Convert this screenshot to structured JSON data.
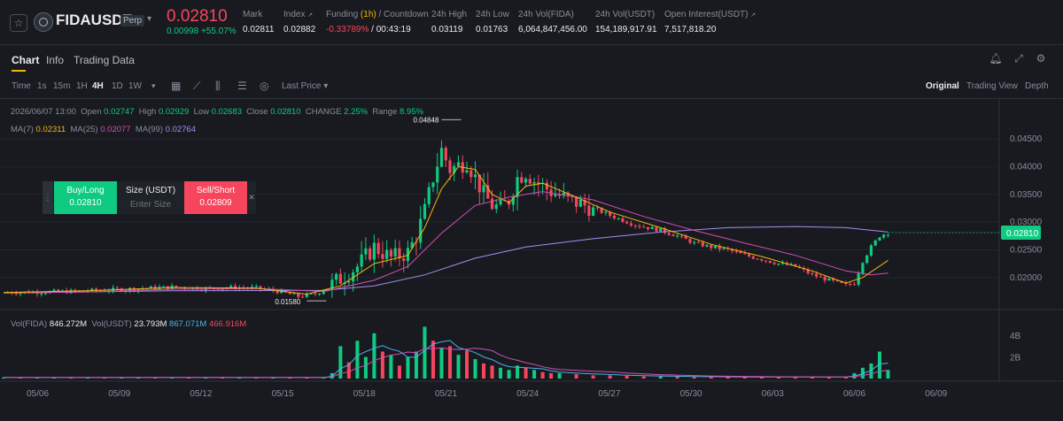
{
  "header": {
    "star_icon": "star-icon",
    "symbol": "FIDAUSDT",
    "contract_type": "Perp",
    "last_price": "0.02810",
    "change_abs": "0.00998",
    "change_pct": "+55.07%",
    "mark_label": "Mark",
    "mark_value": "0.02811",
    "index_label": "Index",
    "index_value": "0.02882",
    "funding_label": "Funding",
    "funding_interval": "(1h)",
    "countdown_label": "/ Countdown",
    "funding_rate": "-0.33789%",
    "countdown_value": "/ 00:43:19",
    "high_label": "24h High",
    "high_value": "0.03119",
    "low_label": "24h Low",
    "low_value": "0.01763",
    "vol_base_label": "24h Vol(FIDA)",
    "vol_base_value": "6,064,847,456.00",
    "vol_quote_label": "24h Vol(USDT)",
    "vol_quote_value": "154,189,917.91",
    "oi_label": "Open Interest(USDT)",
    "oi_value": "7,517,818.20"
  },
  "tabs": [
    {
      "label": "Chart"
    },
    {
      "label": "Info"
    },
    {
      "label": "Trading Data"
    }
  ],
  "toolbar": {
    "intervals": [
      "Time",
      "1s",
      "15m",
      "1H",
      "4H",
      "1D",
      "1W"
    ],
    "active_interval": "4H",
    "price_type": "Last Price",
    "views": [
      "Original",
      "Trading View",
      "Depth"
    ],
    "active_view": "Original"
  },
  "ohlc": {
    "date": "2026/06/07 13:00",
    "open_label": "Open",
    "open": "0.02747",
    "high_label": "High",
    "high": "0.02929",
    "low_label": "Low",
    "low": "0.02683",
    "close_label": "Close",
    "close": "0.02810",
    "change_label": "CHANGE",
    "change": "2.25%",
    "range_label": "Range",
    "range": "8.95%"
  },
  "ma": {
    "ma7_label": "MA(7)",
    "ma7": "0.02311",
    "ma25_label": "MA(25)",
    "ma25": "0.02077",
    "ma99_label": "MA(99)",
    "ma99": "0.02764"
  },
  "trade_panel": {
    "buy_label": "Buy/Long",
    "buy_price": "0.02810",
    "size_label": "Size (USDT)",
    "size_placeholder": "Enter Size",
    "sell_label": "Sell/Short",
    "sell_price": "0.02809"
  },
  "volume_legend": {
    "vol_fida_label": "Vol(FIDA)",
    "vol_fida": "846.272M",
    "vol_usdt_label": "Vol(USDT)",
    "vol_usdt": "23.793M",
    "ma1": "867.071M",
    "ma2": "466.916M"
  },
  "colors": {
    "up": "#0ecb81",
    "down": "#f6465d",
    "accent": "#f0b90b",
    "ma7": "#f0b90b",
    "ma25": "#d34fb5",
    "ma99": "#a68ef0"
  },
  "chart_data": {
    "type": "candlestick",
    "y_axis_ticks": [
      0.045,
      0.04,
      0.035,
      0.03,
      0.025,
      0.02
    ],
    "y_axis_labels": [
      "0.04500",
      "0.04000",
      "0.03500",
      "0.03000",
      "0.02500",
      "0.02000"
    ],
    "ylim": [
      0.0155,
      0.049
    ],
    "x_axis_labels": [
      "05/06",
      "05/09",
      "05/12",
      "05/15",
      "05/18",
      "05/21",
      "05/24",
      "05/27",
      "05/30",
      "06/03",
      "06/06",
      "06/09"
    ],
    "current_price_label": "0.02810",
    "current_price": 0.0281,
    "annotations": [
      {
        "text": "0.04848",
        "value": 0.04848
      },
      {
        "text": "0.01580",
        "value": 0.0158
      }
    ],
    "close_path": [
      [
        0,
        0.0173
      ],
      [
        8,
        0.0175
      ],
      [
        16,
        0.018
      ],
      [
        20,
        0.0183
      ],
      [
        24,
        0.018
      ],
      [
        27,
        0.0182
      ],
      [
        30,
        0.0181
      ],
      [
        33,
        0.0174
      ],
      [
        35,
        0.0166
      ],
      [
        37,
        0.017
      ],
      [
        38,
        0.0178
      ],
      [
        40,
        0.0198
      ],
      [
        42,
        0.022
      ],
      [
        44,
        0.0255
      ],
      [
        46,
        0.0235
      ],
      [
        48,
        0.0245
      ],
      [
        49,
        0.0275
      ],
      [
        50,
        0.032
      ],
      [
        51,
        0.038
      ],
      [
        52,
        0.043
      ],
      [
        53,
        0.0395
      ],
      [
        55,
        0.041
      ],
      [
        56,
        0.038
      ],
      [
        57,
        0.035
      ],
      [
        58,
        0.033
      ],
      [
        59,
        0.0325
      ],
      [
        60,
        0.034
      ],
      [
        61,
        0.038
      ],
      [
        62,
        0.039
      ],
      [
        63,
        0.0375
      ],
      [
        65,
        0.0355
      ],
      [
        67,
        0.034
      ],
      [
        70,
        0.0325
      ],
      [
        72,
        0.0312
      ],
      [
        75,
        0.0295
      ],
      [
        78,
        0.0285
      ],
      [
        80,
        0.0275
      ],
      [
        82,
        0.0262
      ],
      [
        84,
        0.0255
      ],
      [
        86,
        0.025
      ],
      [
        88,
        0.024
      ],
      [
        90,
        0.0233
      ],
      [
        92,
        0.0225
      ],
      [
        94,
        0.022
      ],
      [
        96,
        0.0205
      ],
      [
        98,
        0.0195
      ],
      [
        100,
        0.0186
      ],
      [
        101,
        0.019
      ],
      [
        102,
        0.023
      ],
      [
        103,
        0.0255
      ],
      [
        104,
        0.0275
      ],
      [
        105,
        0.0281
      ]
    ],
    "ma7": [
      [
        0,
        0.0173
      ],
      [
        10,
        0.0176
      ],
      [
        20,
        0.0182
      ],
      [
        30,
        0.0181
      ],
      [
        36,
        0.017
      ],
      [
        40,
        0.0185
      ],
      [
        44,
        0.0225
      ],
      [
        48,
        0.024
      ],
      [
        50,
        0.029
      ],
      [
        52,
        0.036
      ],
      [
        54,
        0.04
      ],
      [
        56,
        0.0395
      ],
      [
        58,
        0.035
      ],
      [
        60,
        0.0335
      ],
      [
        62,
        0.0365
      ],
      [
        64,
        0.037
      ],
      [
        68,
        0.0345
      ],
      [
        72,
        0.0318
      ],
      [
        78,
        0.029
      ],
      [
        84,
        0.026
      ],
      [
        90,
        0.0238
      ],
      [
        96,
        0.0212
      ],
      [
        100,
        0.019
      ],
      [
        102,
        0.02
      ],
      [
        105,
        0.0231
      ]
    ],
    "ma25": [
      [
        0,
        0.0172
      ],
      [
        10,
        0.0174
      ],
      [
        20,
        0.0179
      ],
      [
        30,
        0.018
      ],
      [
        38,
        0.0175
      ],
      [
        44,
        0.0195
      ],
      [
        48,
        0.022
      ],
      [
        52,
        0.028
      ],
      [
        56,
        0.033
      ],
      [
        60,
        0.0345
      ],
      [
        64,
        0.0355
      ],
      [
        70,
        0.034
      ],
      [
        76,
        0.031
      ],
      [
        82,
        0.0285
      ],
      [
        88,
        0.0262
      ],
      [
        94,
        0.024
      ],
      [
        100,
        0.0212
      ],
      [
        103,
        0.0205
      ],
      [
        105,
        0.0208
      ]
    ],
    "ma99": [
      [
        0,
        0.0172
      ],
      [
        20,
        0.0176
      ],
      [
        38,
        0.0177
      ],
      [
        44,
        0.0185
      ],
      [
        50,
        0.0205
      ],
      [
        56,
        0.0235
      ],
      [
        62,
        0.0255
      ],
      [
        70,
        0.027
      ],
      [
        78,
        0.0282
      ],
      [
        86,
        0.029
      ],
      [
        94,
        0.0292
      ],
      [
        100,
        0.029
      ],
      [
        105,
        0.0282
      ]
    ],
    "volume": {
      "axis_labels": [
        "4B",
        "2B"
      ],
      "ylim": [
        0,
        5
      ],
      "bars": [
        [
          0,
          0.1,
          1
        ],
        [
          2,
          0.1,
          0
        ],
        [
          4,
          0.1,
          1
        ],
        [
          6,
          0.1,
          1
        ],
        [
          8,
          0.1,
          0
        ],
        [
          10,
          0.1,
          1
        ],
        [
          12,
          0.1,
          0
        ],
        [
          14,
          0.1,
          1
        ],
        [
          16,
          0.1,
          1
        ],
        [
          18,
          0.1,
          0
        ],
        [
          20,
          0.1,
          1
        ],
        [
          22,
          0.1,
          0
        ],
        [
          24,
          0.1,
          1
        ],
        [
          26,
          0.1,
          0
        ],
        [
          28,
          0.1,
          1
        ],
        [
          30,
          0.1,
          0
        ],
        [
          32,
          0.1,
          1
        ],
        [
          34,
          0.1,
          0
        ],
        [
          36,
          0.1,
          0
        ],
        [
          38,
          0.1,
          1
        ],
        [
          39,
          0.5,
          1
        ],
        [
          40,
          3.0,
          1
        ],
        [
          41,
          1.5,
          0
        ],
        [
          42,
          3.5,
          1
        ],
        [
          43,
          2.0,
          1
        ],
        [
          44,
          4.2,
          1
        ],
        [
          45,
          2.5,
          0
        ],
        [
          46,
          2.2,
          1
        ],
        [
          47,
          1.2,
          0
        ],
        [
          48,
          2.0,
          1
        ],
        [
          49,
          2.5,
          1
        ],
        [
          50,
          4.8,
          1
        ],
        [
          51,
          3.5,
          0
        ],
        [
          52,
          2.8,
          1
        ],
        [
          53,
          3.0,
          0
        ],
        [
          54,
          2.2,
          1
        ],
        [
          55,
          2.6,
          0
        ],
        [
          56,
          1.8,
          1
        ],
        [
          57,
          1.4,
          0
        ],
        [
          58,
          1.2,
          0
        ],
        [
          59,
          1.0,
          1
        ],
        [
          60,
          0.8,
          1
        ],
        [
          61,
          1.2,
          1
        ],
        [
          62,
          1.0,
          0
        ],
        [
          63,
          0.8,
          1
        ],
        [
          64,
          0.6,
          0
        ],
        [
          65,
          0.5,
          0
        ],
        [
          66,
          0.5,
          1
        ],
        [
          68,
          0.4,
          0
        ],
        [
          70,
          0.3,
          0
        ],
        [
          72,
          0.3,
          0
        ],
        [
          74,
          0.25,
          0
        ],
        [
          76,
          0.2,
          0
        ],
        [
          78,
          0.2,
          1
        ],
        [
          80,
          0.2,
          0
        ],
        [
          82,
          0.15,
          0
        ],
        [
          84,
          0.15,
          0
        ],
        [
          86,
          0.15,
          0
        ],
        [
          88,
          0.15,
          0
        ],
        [
          90,
          0.15,
          0
        ],
        [
          92,
          0.15,
          0
        ],
        [
          94,
          0.15,
          0
        ],
        [
          96,
          0.15,
          0
        ],
        [
          98,
          0.15,
          0
        ],
        [
          100,
          0.15,
          0
        ],
        [
          101,
          0.5,
          1
        ],
        [
          102,
          1.0,
          1
        ],
        [
          103,
          1.4,
          1
        ],
        [
          104,
          2.5,
          1
        ],
        [
          105,
          0.8,
          1
        ]
      ]
    }
  }
}
